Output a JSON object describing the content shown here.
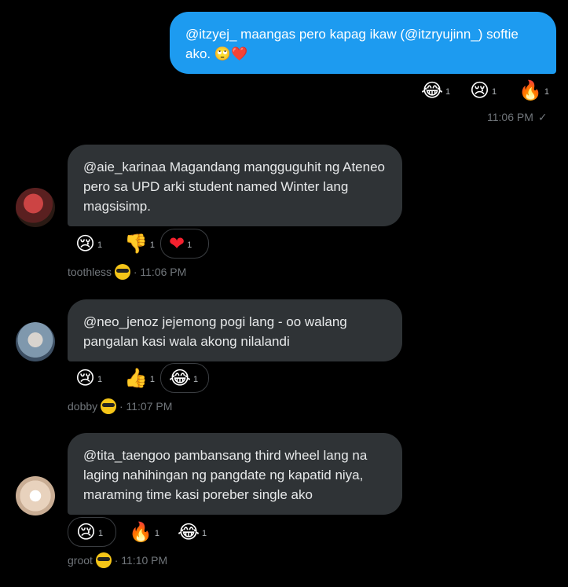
{
  "sent_message": {
    "text": "@itzyej_ maangas pero kapag ikaw (@itzryujinn_) softie ako. 🙄❤️",
    "reactions": [
      {
        "icon": "laughing-tears-icon",
        "glyph": "😂",
        "count": "1"
      },
      {
        "icon": "crying-face-icon",
        "glyph": "😢",
        "count": "1"
      },
      {
        "icon": "fire-icon",
        "glyph": "🔥",
        "count": "1"
      }
    ],
    "time": "11:06 PM",
    "status_glyph": "✓"
  },
  "messages": [
    {
      "text": "@aie_karinaa Magandang mangguguhit ng Ateneo pero sa UPD arki student named Winter lang magsisimp.",
      "reactions": [
        {
          "icon": "crying-face-icon",
          "glyph": "😢",
          "count": "1"
        },
        {
          "icon": "thumbs-down-icon",
          "glyph": "👎",
          "count": "1"
        },
        {
          "icon": "heart-icon",
          "glyph": "❤",
          "count": "1"
        }
      ],
      "sender": "toothless",
      "time": "11:06 PM",
      "avatar_color": "#8a2a2a"
    },
    {
      "text": "@neo_jenoz jejemong pogi lang - oo walang pangalan kasi wala akong nilalandi",
      "reactions": [
        {
          "icon": "crying-face-icon",
          "glyph": "😢",
          "count": "1"
        },
        {
          "icon": "thumbs-up-icon",
          "glyph": "👍",
          "count": "1"
        },
        {
          "icon": "laughing-tears-icon",
          "glyph": "😂",
          "count": "1"
        }
      ],
      "sender": "dobby",
      "time": "11:07 PM",
      "avatar_color": "#6f8fa8"
    },
    {
      "text": "@tita_taengoo pambansang third wheel lang na laging nahihingan ng pangdate ng kapatid niya, maraming time kasi poreber single ako",
      "reactions": [
        {
          "icon": "crying-face-icon",
          "glyph": "😢",
          "count": "1"
        },
        {
          "icon": "fire-icon",
          "glyph": "🔥",
          "count": "1"
        },
        {
          "icon": "laughing-tears-icon",
          "glyph": "😂",
          "count": "1"
        }
      ],
      "sender": "groot",
      "time": "11:10 PM",
      "avatar_color": "#d8c4b2"
    }
  ],
  "separator": "·"
}
